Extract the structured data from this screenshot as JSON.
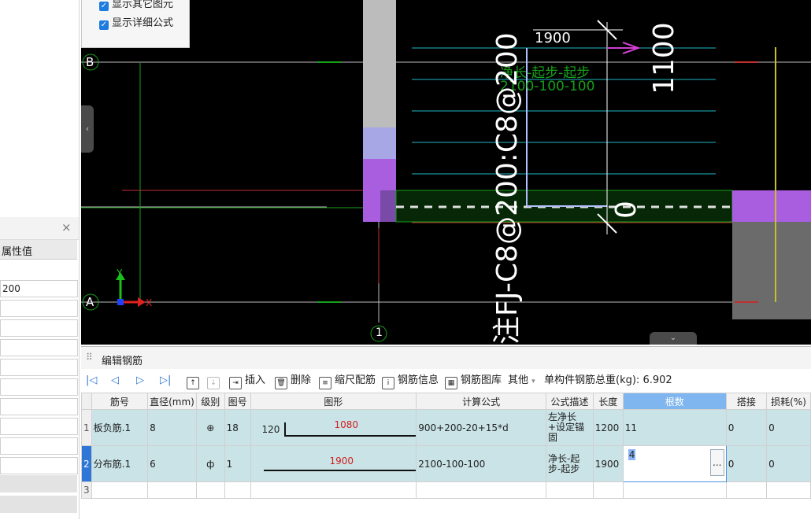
{
  "options_panel": {
    "show_other": "显示其它图元",
    "show_formula": "显示详细公式"
  },
  "left_panel": {
    "close": "×",
    "col_header": "属性值",
    "first_value": "200"
  },
  "canvas": {
    "axis_b": "B",
    "axis_a": "A",
    "axis_1": "1",
    "y_label": "Y",
    "x_label": "X",
    "vertical_text": "注FJ-C8@200:C8@200",
    "len_1900": "1900",
    "len_1100": "1100",
    "zero": "0",
    "formula_name": "净长-起步-起步",
    "formula_value": "2100-100-100",
    "colors": {
      "cyan": "#1fb7c4",
      "green": "#18a018",
      "purple": "#a95ee0",
      "darkgreen": "#062806",
      "magenta": "#d040d0"
    }
  },
  "editor": {
    "title": "编辑钢筋",
    "toolbar": {
      "insert": "插入",
      "delete": "删除",
      "scale": "缩尺配筋",
      "info": "钢筋信息",
      "library": "钢筋图库",
      "other": "其他",
      "total_label": "单构件钢筋总重(kg):",
      "total_value": "6.902"
    },
    "columns": [
      "筋号",
      "直径(mm)",
      "级别",
      "图号",
      "图形",
      "计算公式",
      "公式描述",
      "长度",
      "根数",
      "搭接",
      "损耗(%)"
    ],
    "rows": [
      {
        "num": "1",
        "name": "板负筋.1",
        "dia": "8",
        "grade": "⊕",
        "fig": "18",
        "shape_left": "120",
        "shape_mid": "1080",
        "formula": "900+200-20+15*d",
        "desc": "左净长+设定锚固",
        "length": "1200",
        "count": "11",
        "lap": "0",
        "loss": "0"
      },
      {
        "num": "2",
        "name": "分布筋.1",
        "dia": "6",
        "grade": "ф",
        "fig": "1",
        "shape_mid": "1900",
        "formula": "2100-100-100",
        "desc": "净长-起步-起步",
        "length": "1900",
        "count": "4",
        "lap": "0",
        "loss": "0",
        "ellipsis": "..."
      },
      {
        "num": "3"
      }
    ]
  }
}
